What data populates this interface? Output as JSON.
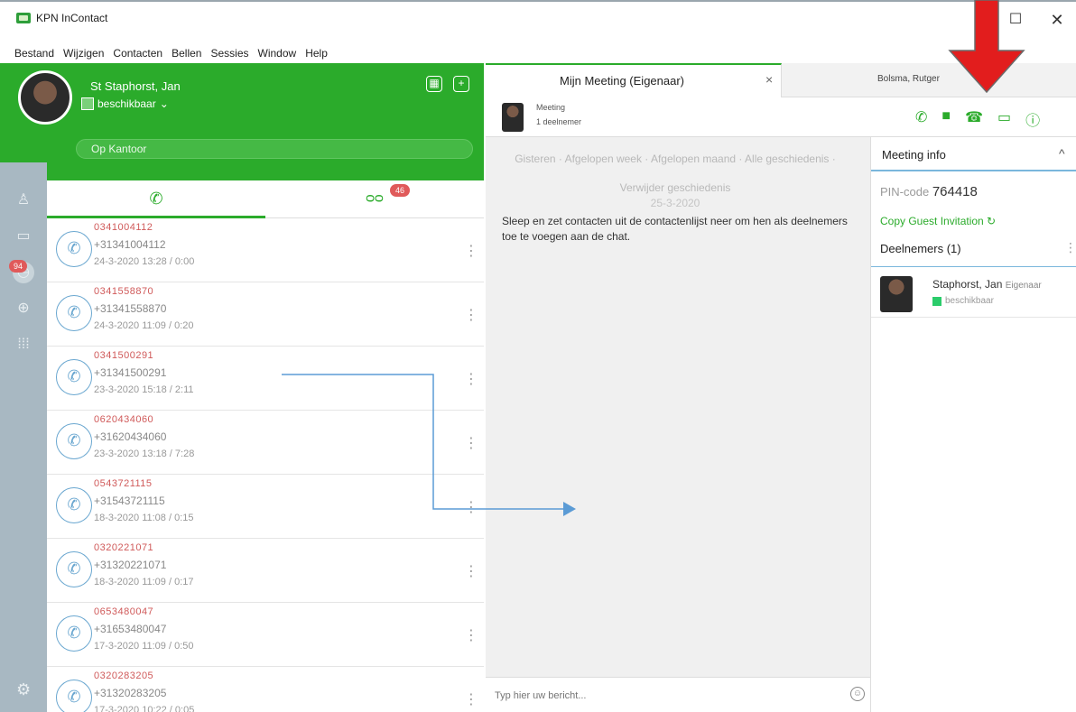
{
  "window": {
    "title": "KPN InContact",
    "maximize": "☐",
    "close": "✕"
  },
  "menu": [
    "Bestand",
    "Wijzigen",
    "Contacten",
    "Bellen",
    "Sessies",
    "Window",
    "Help"
  ],
  "profile": {
    "name": "St Staphorst, Jan",
    "status": "beschikbaar",
    "location": "Op Kantoor"
  },
  "rail_badge": "94",
  "list_tabs": {
    "voicemail_badge": "46"
  },
  "calls": [
    {
      "name": "0341004112",
      "number": "+31341004112",
      "time": "24-3-2020 13:28 / 0:00"
    },
    {
      "name": "0341558870",
      "number": "+31341558870",
      "time": "24-3-2020 11:09 / 0:20"
    },
    {
      "name": "0341500291",
      "number": "+31341500291",
      "time": "23-3-2020 15:18 / 2:11"
    },
    {
      "name": "0620434060",
      "number": "+31620434060",
      "time": "23-3-2020 13:18 / 7:28"
    },
    {
      "name": "0543721115",
      "number": "+31543721115",
      "time": "18-3-2020 11:08 / 0:15"
    },
    {
      "name": "0320221071",
      "number": "+31320221071",
      "time": "18-3-2020 11:09 / 0:17"
    },
    {
      "name": "0653480047",
      "number": "+31653480047",
      "time": "17-3-2020 11:09 / 0:50"
    },
    {
      "name": "0320283205",
      "number": "+31320283205",
      "time": "17-3-2020 10:22 / 0:05"
    }
  ],
  "tabs": {
    "meeting": "Mijn Meeting (Eigenaar)",
    "other": "Bolsma, Rutger"
  },
  "meeting_head": {
    "title": "Meeting",
    "participants": "1 deelnemer"
  },
  "history": {
    "links": "Gisteren  ·  Afgelopen week  ·  Afgelopen maand  ·  Alle geschiedenis  ·  Verwijder geschiedenis",
    "date": "25-3-2020"
  },
  "drop_hint": "Sleep en zet contacten uit de contactenlijst neer om hen als deelnemers toe te voegen aan de chat.",
  "composer": {
    "placeholder": "Typ hier uw bericht..."
  },
  "info": {
    "title": "Meeting info",
    "pin_label": "PIN-code ",
    "pin": "764418",
    "guest": "Copy Guest Invitation ↻",
    "participants_label": "Deelnemers (1)",
    "member": {
      "name": "Staphorst, Jan",
      "role": "Eigenaar",
      "status": "beschikbaar"
    }
  },
  "colors": {
    "brand_green": "#2bab2b",
    "rail": "#a8b8c2",
    "missed_red": "#d05a5a",
    "call_blue": "#6aa7d0",
    "annotation_red": "#e21d1d",
    "annotation_blue": "#5b9bd5"
  }
}
